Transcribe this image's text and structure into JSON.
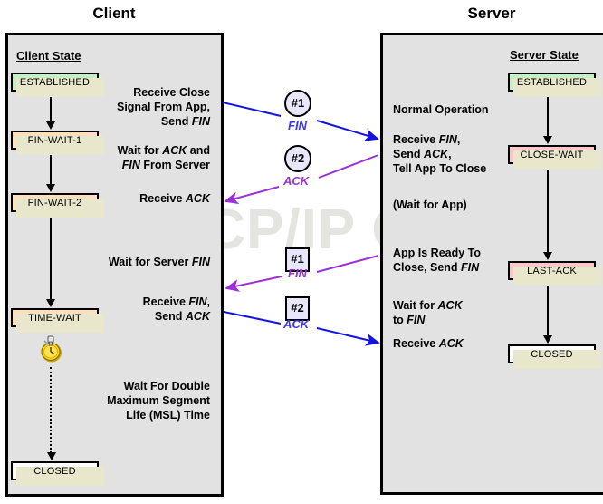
{
  "columns": {
    "client_title": "Client",
    "server_title": "Server"
  },
  "client": {
    "state_heading": "Client State",
    "states": [
      {
        "label": "ESTABLISHED",
        "color": "#c4f0c4"
      },
      {
        "label": "FIN-WAIT-1",
        "color": "#ffdfc0"
      },
      {
        "label": "FIN-WAIT-2",
        "color": "#ffdfc0"
      },
      {
        "label": "TIME-WAIT",
        "color": "#ffdfc0"
      },
      {
        "label": "CLOSED",
        "color": "#ffffff"
      }
    ],
    "events": [
      "Receive Close\nSignal From App,\nSend FIN",
      "Wait for ACK and\nFIN From Server",
      "Receive ACK",
      "Wait for Server FIN",
      "Receive FIN,\nSend ACK",
      "Wait For Double\nMaximum Segment\nLife (MSL) Time"
    ]
  },
  "server": {
    "state_heading": "Server State",
    "states": [
      {
        "label": "ESTABLISHED",
        "color": "#c4f0c4"
      },
      {
        "label": "CLOSE-WAIT",
        "color": "#ffc8c8"
      },
      {
        "label": "LAST-ACK",
        "color": "#ffc8c8"
      },
      {
        "label": "CLOSED",
        "color": "#ffffff"
      }
    ],
    "events": [
      "Normal Operation",
      "Receive FIN,\nSend ACK,\nTell App To Close",
      "(Wait for App)",
      "App Is Ready To\nClose, Send FIN",
      "Wait for ACK\nto FIN",
      "Receive ACK"
    ]
  },
  "messages": [
    {
      "marker": "#1",
      "label": "FIN",
      "shape": "circle",
      "color": "#3b3bf5",
      "direction": "client-to-server"
    },
    {
      "marker": "#2",
      "label": "ACK",
      "shape": "circle",
      "color": "#9b30d9",
      "direction": "server-to-client"
    },
    {
      "marker": "#1",
      "label": "FIN",
      "shape": "square",
      "color": "#9b30d9",
      "direction": "server-to-client"
    },
    {
      "marker": "#2",
      "label": "ACK",
      "shape": "square",
      "color": "#3b3bf5",
      "direction": "client-to-server"
    }
  ],
  "watermark": "The TCP/IP Guide",
  "icons": {
    "timer": "stopwatch-icon"
  },
  "colors": {
    "panel_bg": "#e2e2e2",
    "established": "#c4f0c4",
    "fin_wait": "#ffdfc0",
    "close_wait": "#ffc8c8",
    "closed": "#ffffff",
    "fin_arrow": "#3b3bf5",
    "ack_arrow": "#9b30d9",
    "marker_bg": "#e8e6fb"
  }
}
